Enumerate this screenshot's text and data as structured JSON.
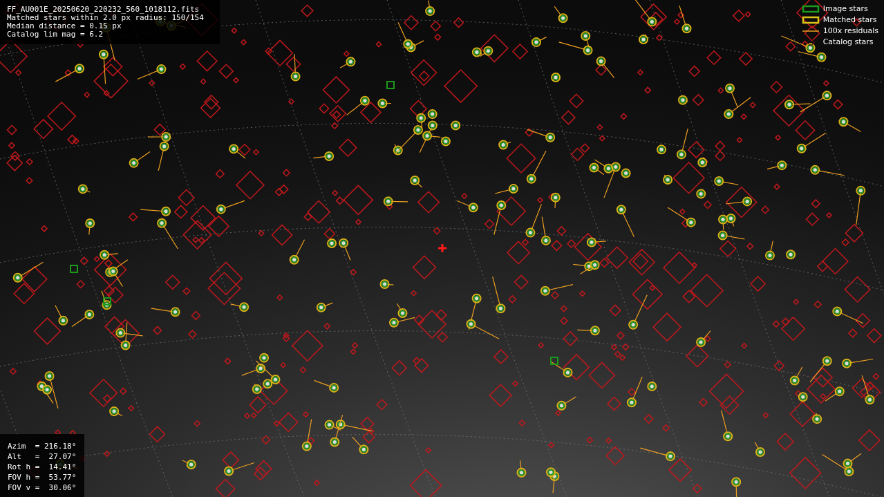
{
  "header": {
    "lines": [
      "FF_AU001E_20250620_220232_560_1018112.fits",
      "Matched stars within 2.0 px radius: 150/154",
      "Median distance = 0.15 px",
      "Catalog lim mag = 6.2"
    ]
  },
  "legend": [
    {
      "label": "Image stars",
      "kind": "image"
    },
    {
      "label": "Matched stars",
      "kind": "matched"
    },
    {
      "label": "100x residuals",
      "kind": "residual"
    },
    {
      "label": "Catalog stars",
      "kind": "catalog"
    }
  ],
  "pointing": {
    "lines": [
      "Azim  = 216.18°",
      "Alt   =  27.07°",
      "Rot h =  14.41°",
      "FOV h =  53.77°",
      "FOV v =  30.06°"
    ]
  }
}
